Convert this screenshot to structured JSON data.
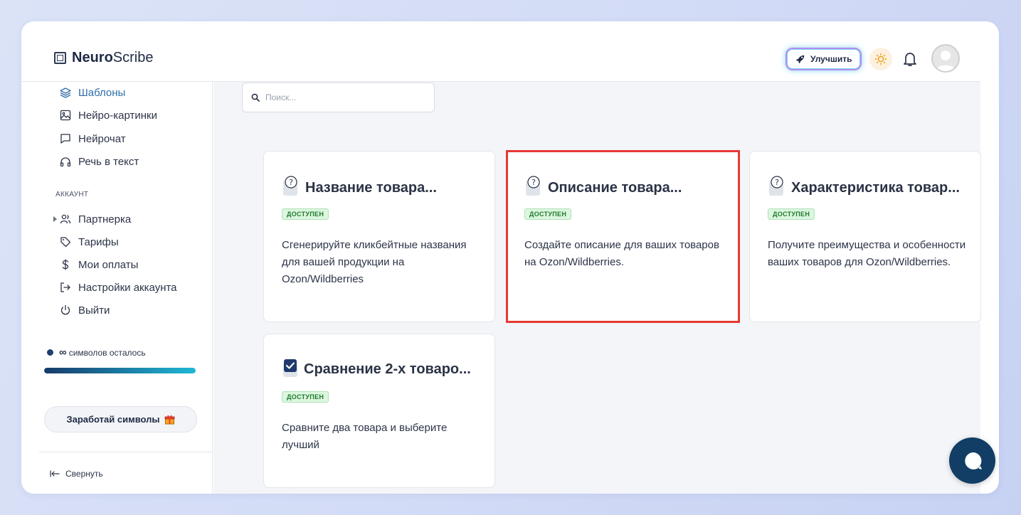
{
  "app": {
    "logo_bold": "Neuro",
    "logo_light": "Scribe"
  },
  "header": {
    "upgrade_label": "Улучшить"
  },
  "sidebar": {
    "items": [
      {
        "label": "Шаблоны",
        "icon": "layers-icon"
      },
      {
        "label": "Нейро-картинки",
        "icon": "image-icon"
      },
      {
        "label": "Нейрочат",
        "icon": "chat-icon"
      },
      {
        "label": "Речь в текст",
        "icon": "headphones-icon"
      }
    ],
    "account_label": "АККАУНТ",
    "account_items": [
      {
        "label": "Партнерка",
        "icon": "users-icon"
      },
      {
        "label": "Тарифы",
        "icon": "tag-icon"
      },
      {
        "label": "Мои оплаты",
        "icon": "dollar-icon"
      },
      {
        "label": "Настройки аккаунта",
        "icon": "login-icon"
      },
      {
        "label": "Выйти",
        "icon": "power-icon"
      }
    ],
    "symbols_value": "∞",
    "symbols_text": "символов осталось",
    "symbols_progress": 1.0,
    "earn_label": "Заработай символы",
    "collapse_label": "Свернуть"
  },
  "search": {
    "placeholder": "Поиск..."
  },
  "cards": [
    {
      "title": "Название товара...",
      "badge": "ДОСТУПЕН",
      "description": "Сгенерируйте кликбейтные названия для вашей продукции на Ozon/Wildberries"
    },
    {
      "title": "Описание товара...",
      "badge": "ДОСТУПЕН",
      "description": "Создайте описание для ваших товаров на Ozon/Wildberries."
    },
    {
      "title": "Характеристика товар...",
      "badge": "ДОСТУПЕН",
      "description": "Получите преимущества и особенности ваших товаров для Ozon/Wildberries."
    },
    {
      "title": "Сравнение 2-х товаро...",
      "badge": "ДОСТУПЕН",
      "description": "Сравните два товара и выберите лучший"
    }
  ],
  "colors": {
    "accent": "#2f6fa8",
    "highlight": "#e53935",
    "badge_bg": "#dcf6df",
    "chat_bg": "#123e66"
  }
}
